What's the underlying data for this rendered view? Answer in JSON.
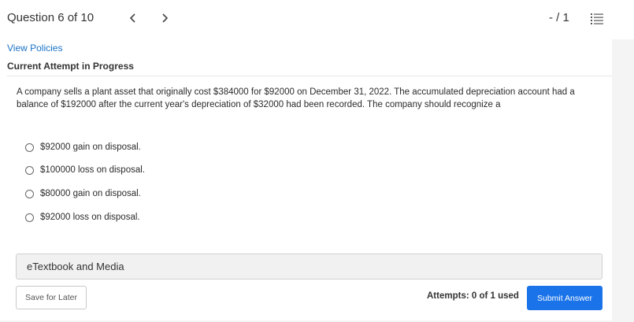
{
  "header": {
    "question_counter": "Question 6 of 10",
    "score": "- / 1",
    "prev_icon": "chevron-left-icon",
    "next_icon": "chevron-right-icon",
    "list_icon": "numbered-list-icon"
  },
  "links": {
    "view_policies": "View Policies"
  },
  "status": {
    "attempt": "Current Attempt in Progress"
  },
  "question": {
    "text": "A company sells a plant asset that originally cost $384000 for $92000 on December 31, 2022. The accumulated depreciation account had a balance of $192000 after the current year's depreciation of $32000 had been recorded. The company should recognize a",
    "options": [
      {
        "label": "$92000 gain on disposal."
      },
      {
        "label": "$100000 loss on disposal."
      },
      {
        "label": "$80000 gain on disposal."
      },
      {
        "label": "$92000 loss on disposal."
      }
    ]
  },
  "resources": {
    "etextbook": "eTextbook and Media"
  },
  "footer": {
    "save_label": "Save for Later",
    "attempts_text": "Attempts: 0 of 1 used",
    "submit_label": "Submit Answer"
  },
  "colors": {
    "accent": "#1a73e8",
    "link": "#1a73c8"
  }
}
